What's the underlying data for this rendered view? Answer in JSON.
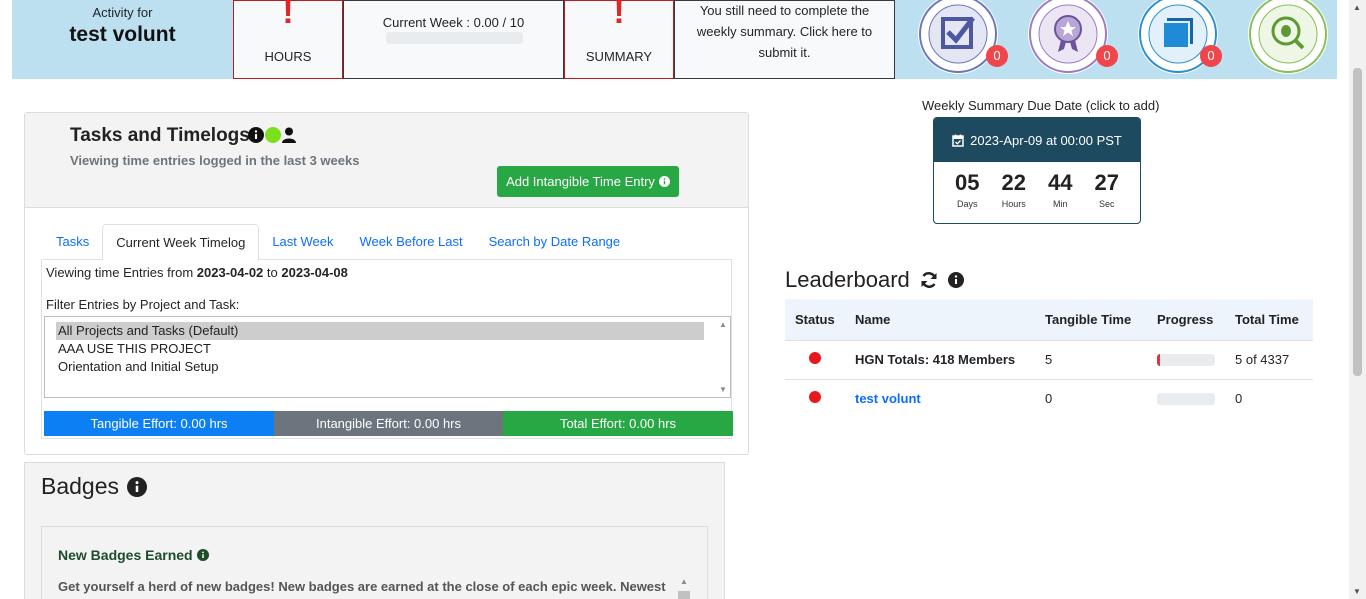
{
  "topbar": {
    "activity_label": "Activity for",
    "user_name": "test volunt",
    "hours": {
      "alert": "!",
      "caption": "HOURS"
    },
    "current_week": {
      "text": "Current Week : 0.00 / 10",
      "progress": 0
    },
    "summary": {
      "alert": "!",
      "caption": "SUMMARY"
    },
    "summary_notice": "You still need to complete the weekly summary. Click here to submit it.",
    "badges": [
      {
        "icon": "checkbox-badge-icon",
        "count": "0",
        "color": "#5a63a8"
      },
      {
        "icon": "earned-star-badge-icon",
        "count": "0",
        "color": "#8a6bb5"
      },
      {
        "icon": "blue-square-badge-icon",
        "count": "0",
        "color": "#1f7fc4"
      },
      {
        "icon": "app-bug-badge-icon",
        "count": "",
        "color": "#7ab648"
      }
    ]
  },
  "tasks": {
    "title": "Tasks and Timelogs",
    "subtitle": "Viewing time entries logged in the last 3 weeks",
    "add_button": "Add Intangible Time Entry",
    "tabs": [
      "Tasks",
      "Current Week Timelog",
      "Last Week",
      "Week Before Last",
      "Search by Date Range"
    ],
    "active_tab": "Current Week Timelog",
    "viewing_prefix": "Viewing time Entries from",
    "date_from": "2023-04-02",
    "viewing_to": "to",
    "date_to": "2023-04-08",
    "filter_label": "Filter Entries by Project and Task:",
    "filter_options": [
      "All Projects and Tasks (Default)",
      "AAA USE THIS PROJECT",
      "Orientation and Initial Setup"
    ],
    "selected_option": "All Projects and Tasks (Default)",
    "tangible": "Tangible Effort: 0.00 hrs",
    "intangible": "Intangible Effort: 0.00 hrs",
    "total": "Total Effort: 0.00 hrs"
  },
  "badges_section": {
    "title": "Badges",
    "new_title": "New Badges Earned",
    "new_text": "Get yourself a herd of new badges! New badges are earned at the close of each epic week. Newest"
  },
  "due": {
    "label": "Weekly Summary Due Date (click to add)",
    "date": "2023-Apr-09 at 00:00 PST",
    "days": "05",
    "days_label": "Days",
    "hours": "22",
    "hours_label": "Hours",
    "min": "44",
    "min_label": "Min",
    "sec": "27",
    "sec_label": "Sec"
  },
  "leaderboard": {
    "title": "Leaderboard",
    "columns": [
      "Status",
      "Name",
      "Tangible Time",
      "Progress",
      "Total Time"
    ],
    "rows": [
      {
        "name": "HGN Totals: 418 Members",
        "tangible": "5",
        "progress": 0.05,
        "total": "5 of 4337"
      },
      {
        "name": "test volunt",
        "tangible": "0",
        "progress": 0,
        "total": "0"
      }
    ]
  }
}
